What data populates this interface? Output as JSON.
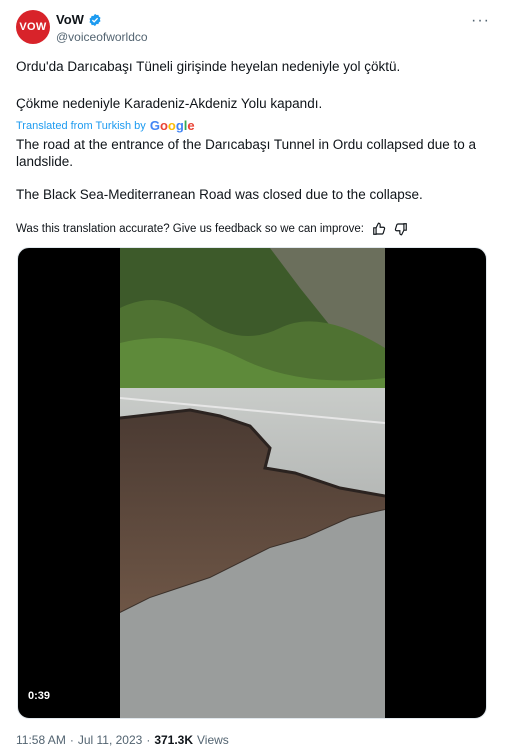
{
  "header": {
    "avatar_text": "VOW",
    "display_name": "VoW",
    "handle": "@voiceofworldco"
  },
  "tweet": {
    "original_line1": "Ordu'da Darıcabaşı Tüneli girişinde heyelan nedeniyle yol çöktü.",
    "original_line2": "Çökme nedeniyle Karadeniz-Akdeniz Yolu kapandı.",
    "translated_label": "Translated from Turkish by",
    "translated_brand": "Google",
    "translation_line1": "The road at the entrance of the Darıcabaşı Tunnel in Ordu collapsed due to a landslide.",
    "translation_line2": "The Black Sea-Mediterranean Road was closed due to the collapse.",
    "feedback_text": "Was this translation accurate? Give us feedback so we can improve:"
  },
  "media": {
    "duration": "0:39"
  },
  "meta": {
    "time": "11:58 AM",
    "sep1": "·",
    "date": "Jul 11, 2023",
    "sep2": "·",
    "views_count": "371.3K",
    "views_label": "Views"
  },
  "colors": {
    "avatar": "#d8232a",
    "link": "#1d9bf0",
    "muted": "#536471"
  }
}
